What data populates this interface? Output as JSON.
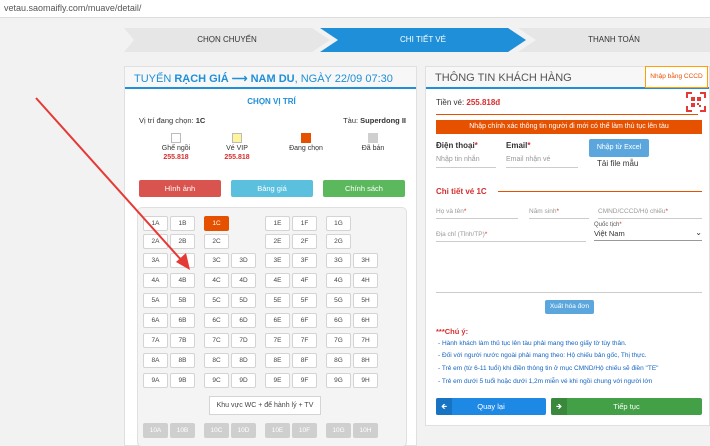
{
  "url": "vetau.saomaifly.com/muave/detail/",
  "steps": [
    "CHỌN CHUYẾN",
    "CHI TIẾT VÉ",
    "THANH TOÁN"
  ],
  "left": {
    "title_prefix": "TUYẾN ",
    "title_route": "RẠCH GIÁ ⟶ NAM DU",
    "title_suffix": ", NGÀY 22/09 07:30",
    "chon_vi_tri": "CHỌN VỊ TRÍ",
    "vt_label": "Vị trí đang chọn: ",
    "vt_value": "1C",
    "tau_label": "Tàu: ",
    "tau_value": "Superdong II",
    "legend": [
      {
        "label": "Ghế ngồi",
        "price": "255.818",
        "color": "#ffffff"
      },
      {
        "label": "Vé VIP",
        "price": "255.818",
        "color": "#fff59d"
      },
      {
        "label": "Đang chọn",
        "price": "",
        "color": "#e65100"
      },
      {
        "label": "Đã bán",
        "price": "",
        "color": "#cfcfcf"
      }
    ],
    "btn_hinh": "Hình ảnh",
    "btn_bang": "Bảng giá",
    "btn_chinh": "Chính sách",
    "wc_label": "Khu vực WC + để hành lý + TV",
    "seats": {
      "r1": [
        "1A",
        "1B",
        "1C",
        "1E",
        "1F",
        "1G"
      ],
      "r2": [
        "2A",
        "2B",
        "2C",
        "2E",
        "2F",
        "2G"
      ],
      "grid_rows": [
        "3",
        "4",
        "5",
        "6",
        "7",
        "8",
        "9"
      ],
      "grid_cols": [
        "A",
        "B",
        "C",
        "D",
        "E",
        "F",
        "G",
        "H"
      ],
      "bottom": [
        "10A",
        "10B",
        "10C",
        "10D",
        "10E",
        "10F",
        "10G",
        "10H"
      ]
    }
  },
  "right": {
    "title": "THÔNG TIN KHÁCH HÀNG",
    "tien_ve_label": "Tiền vé: ",
    "tien_ve_value": "255.818đ",
    "warn": "Nhập chính xác thông tin người đi mới có thể làm thủ tục lên tàu",
    "phone_label": "Điện thoại",
    "phone_placeholder": "Nhập tin nhắn",
    "email_label": "Email",
    "email_placeholder": "Email nhận vé",
    "btn_excel": "Nhập từ Excel",
    "tai_file": "Tải file mẫu",
    "chi_tiet": "Chi tiết vé 1C",
    "ho_ten": "Họ và tên",
    "nam_sinh": "Năm sinh",
    "cmnd": "CMND/CCCD/Hộ chiếu",
    "dia_chi": "Địa chỉ (Tỉnh/TP)",
    "quoc_tich_label": "Quốc tịch",
    "quoc_tich_value": "Việt Nam",
    "btn_xuat": "Xuất hóa đơn",
    "chuy": "***Chú ý:",
    "notes": [
      "- Hành khách làm thủ tục lên tàu phải mang theo giấy tờ tùy thân.",
      "- Đối với người nước ngoài phải mang theo: Hộ chiếu bản gốc, Thị thực.",
      "- Trẻ em (từ 6-11 tuổi) khi điền thông tin ở mục CMND/Hộ chiếu sẽ điền \"TE\"",
      "- Trẻ em dưới 5 tuổi hoặc dưới 1,2m miễn vé khi ngồi chung với người lớn"
    ],
    "btn_back": "Quay lại",
    "btn_next": "Tiếp tục"
  },
  "cccd": "Nhập bằng CCCD",
  "colors": {
    "accent": "#1e8fd8",
    "orange": "#e65100",
    "red_arrow": "#e53935"
  }
}
